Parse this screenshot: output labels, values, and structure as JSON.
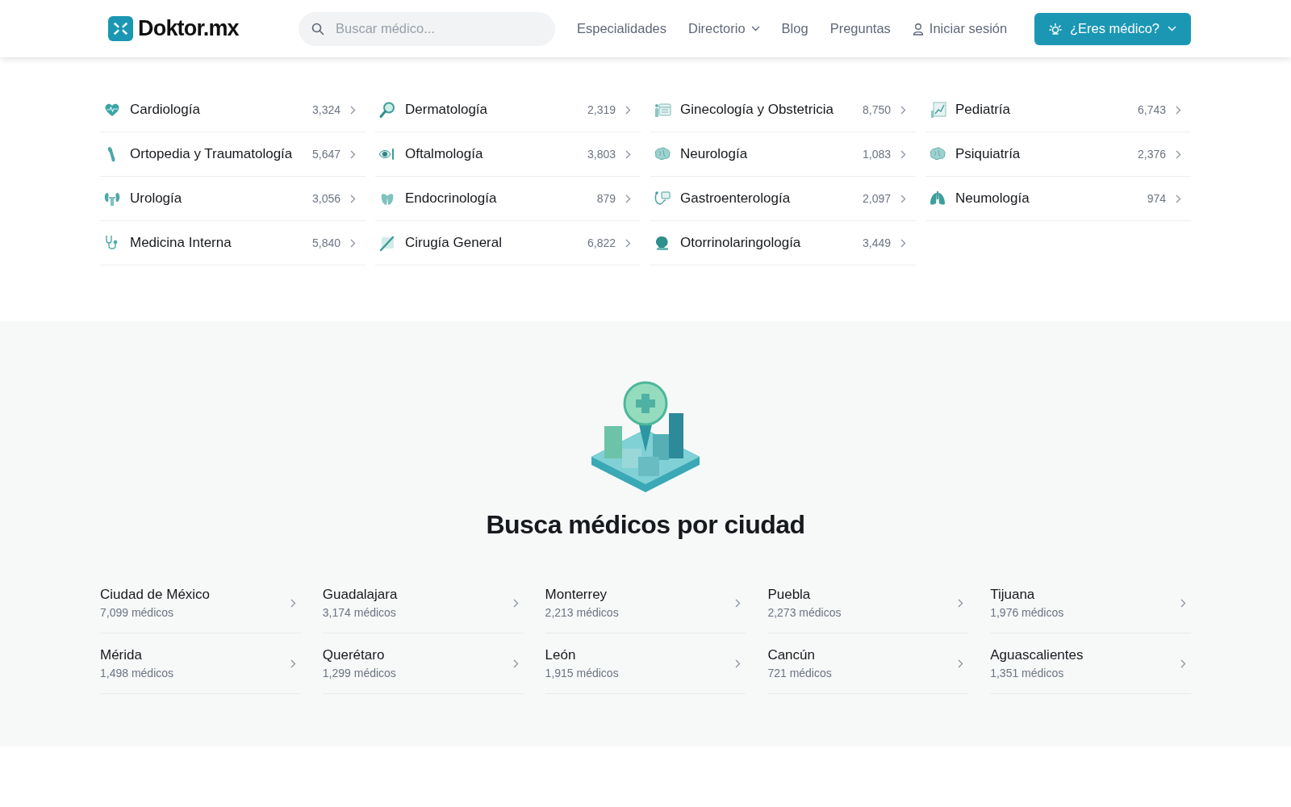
{
  "header": {
    "logo": "Doktor.mx",
    "search": {
      "placeholder": "Buscar médico..."
    },
    "nav": [
      {
        "label": "Especialidades",
        "kind": "link"
      },
      {
        "label": "Directorio",
        "kind": "dropdown"
      },
      {
        "label": "Blog",
        "kind": "link"
      },
      {
        "label": "Preguntas",
        "kind": "link"
      },
      {
        "label": "Iniciar sesión",
        "kind": "user"
      }
    ],
    "cta": "¿Eres médico?"
  },
  "specialties": {
    "items": [
      {
        "name": "Cardiología",
        "count": "3,324"
      },
      {
        "name": "Dermatología",
        "count": "2,319"
      },
      {
        "name": "Ginecología y Obstetricia",
        "count": "8,750"
      },
      {
        "name": "Pediatría",
        "count": "6,743"
      },
      {
        "name": "Ortopedia y Traumatología",
        "count": "5,647"
      },
      {
        "name": "Oftalmología",
        "count": "3,803"
      },
      {
        "name": "Neurología",
        "count": "1,083"
      },
      {
        "name": "Psiquiatría",
        "count": "2,376"
      },
      {
        "name": "Urología",
        "count": "3,056"
      },
      {
        "name": "Endocrinología",
        "count": "879"
      },
      {
        "name": "Gastroenterología",
        "count": "2,097"
      },
      {
        "name": "Neumología",
        "count": "974"
      },
      {
        "name": "Medicina Interna",
        "count": "5,840"
      },
      {
        "name": "Cirugía General",
        "count": "6,822"
      },
      {
        "name": "Otorrinolaringología",
        "count": "3,449"
      }
    ]
  },
  "cities": {
    "title": "Busca médicos por ciudad",
    "items": [
      {
        "name": "Ciudad de México",
        "count": "7,099 médicos"
      },
      {
        "name": "Guadalajara",
        "count": "3,174 médicos"
      },
      {
        "name": "Monterrey",
        "count": "2,213 médicos"
      },
      {
        "name": "Puebla",
        "count": "2,273 médicos"
      },
      {
        "name": "Tijuana",
        "count": "1,976 médicos"
      },
      {
        "name": "Mérida",
        "count": "1,498 médicos"
      },
      {
        "name": "Querétaro",
        "count": "1,299 médicos"
      },
      {
        "name": "León",
        "count": "1,915 médicos"
      },
      {
        "name": "Cancún",
        "count": "721 médicos"
      },
      {
        "name": "Aguascalientes",
        "count": "1,351 médicos"
      }
    ]
  }
}
